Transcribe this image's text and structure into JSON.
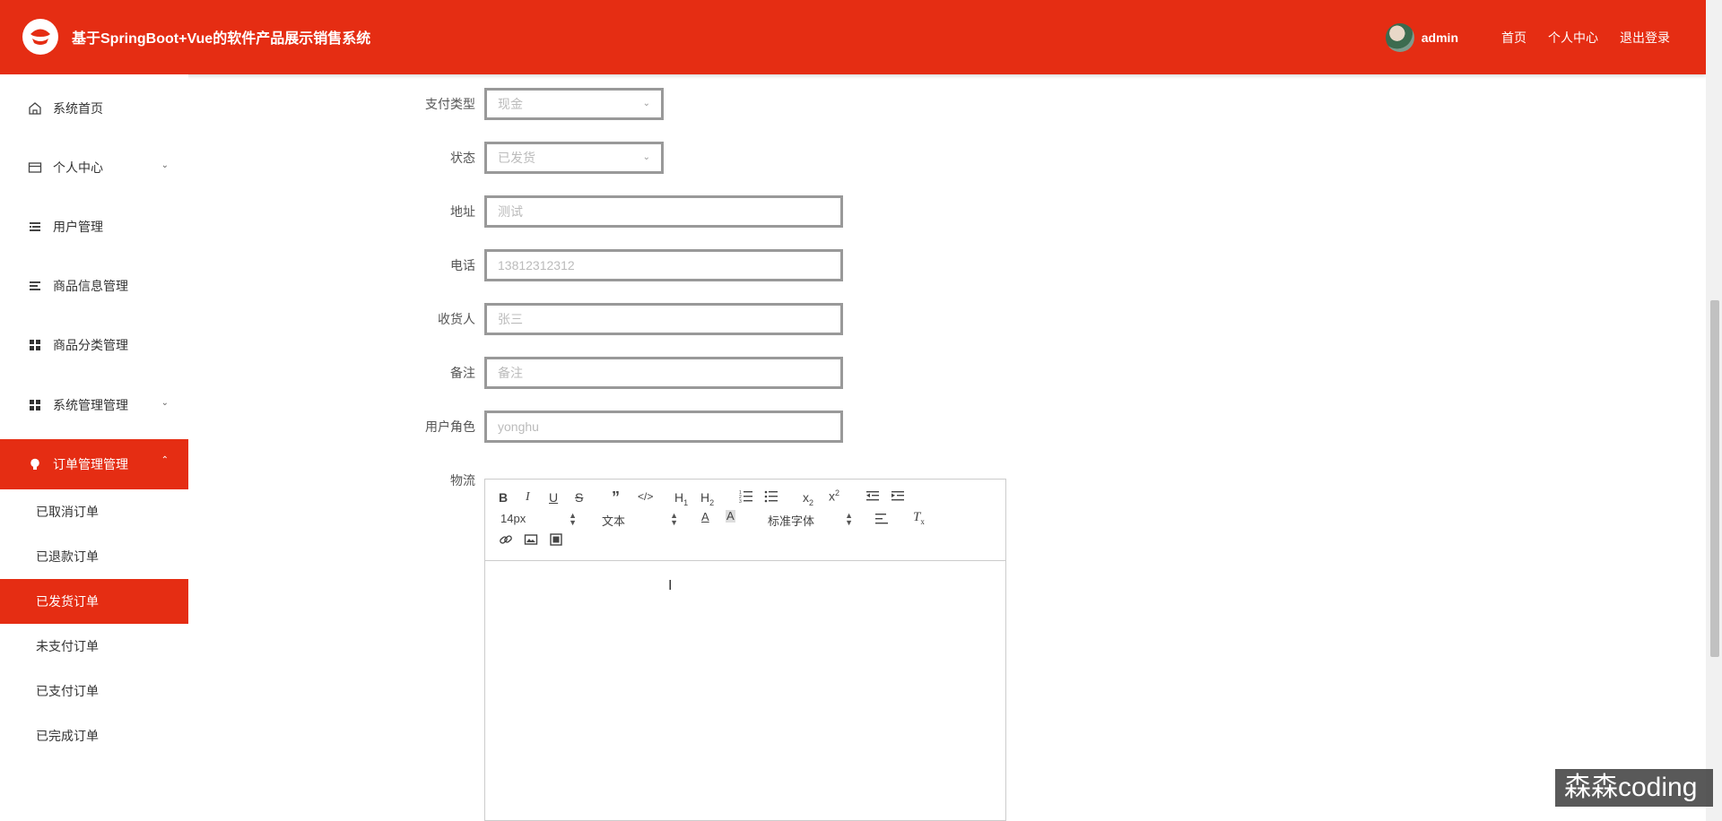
{
  "header": {
    "title": "基于SpringBoot+Vue的软件产品展示销售系统",
    "user": "admin",
    "links": [
      "首页",
      "个人中心",
      "退出登录"
    ]
  },
  "sidebar": {
    "items": [
      {
        "label": "系统首页",
        "icon": "home-icon"
      },
      {
        "label": "个人中心",
        "icon": "card-icon",
        "chevron": "down"
      },
      {
        "label": "用户管理",
        "icon": "list-icon"
      },
      {
        "label": "商品信息管理",
        "icon": "list-icon"
      },
      {
        "label": "商品分类管理",
        "icon": "grid-icon"
      },
      {
        "label": "系统管理管理",
        "icon": "grid-icon",
        "chevron": "down"
      },
      {
        "label": "订单管理管理",
        "icon": "bulb-icon",
        "chevron": "up",
        "active": true
      }
    ],
    "sub_items": [
      {
        "label": "已取消订单"
      },
      {
        "label": "已退款订单"
      },
      {
        "label": "已发货订单",
        "active": true
      },
      {
        "label": "未支付订单"
      },
      {
        "label": "已支付订单"
      },
      {
        "label": "已完成订单"
      }
    ]
  },
  "form": {
    "payment_type": {
      "label": "支付类型",
      "value": "现金"
    },
    "status": {
      "label": "状态",
      "value": "已发货"
    },
    "address": {
      "label": "地址",
      "value": "测试"
    },
    "phone": {
      "label": "电话",
      "value": "13812312312"
    },
    "receiver": {
      "label": "收货人",
      "value": "张三"
    },
    "remark": {
      "label": "备注",
      "value": "备注"
    },
    "user_role": {
      "label": "用户角色",
      "value": "yonghu"
    },
    "logistics": {
      "label": "物流"
    }
  },
  "editor": {
    "font_size": "14px",
    "header_select": "文本",
    "font_family": "标准字体"
  },
  "watermark": "森森coding",
  "colors": {
    "accent": "#e52d13"
  }
}
